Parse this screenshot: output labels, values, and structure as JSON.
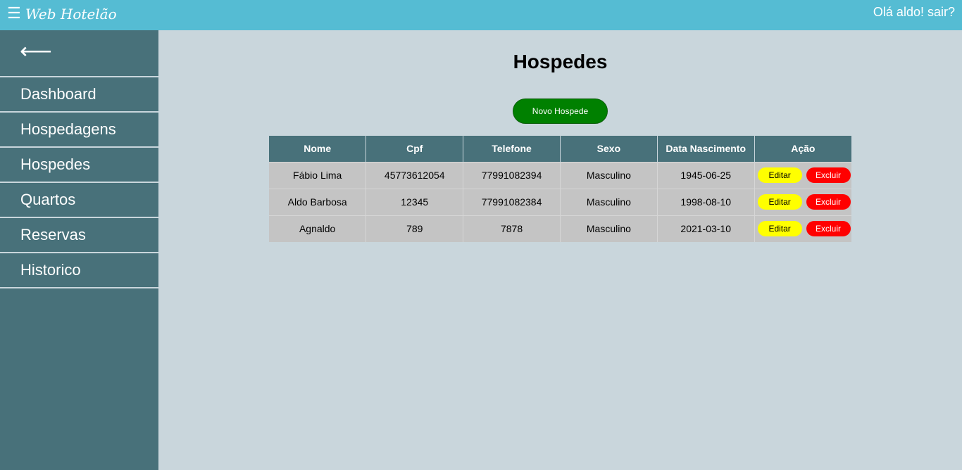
{
  "header": {
    "menu_icon": "☰",
    "brand": "Web Hotelão",
    "greeting": "Olá aldo!",
    "logout": "sair?"
  },
  "sidebar": {
    "back_icon": "⟵",
    "items": [
      {
        "label": "Dashboard"
      },
      {
        "label": "Hospedagens"
      },
      {
        "label": "Hospedes"
      },
      {
        "label": "Quartos"
      },
      {
        "label": "Reservas"
      },
      {
        "label": "Historico"
      }
    ]
  },
  "main": {
    "title": "Hospedes",
    "new_button": "Novo Hospede",
    "table": {
      "headers": [
        "Nome",
        "Cpf",
        "Telefone",
        "Sexo",
        "Data Nascimento",
        "Ação"
      ],
      "rows": [
        {
          "nome": "Fábio Lima",
          "cpf": "45773612054",
          "telefone": "77991082394",
          "sexo": "Masculino",
          "nascimento": "1945-06-25"
        },
        {
          "nome": "Aldo Barbosa",
          "cpf": "12345",
          "telefone": "77991082384",
          "sexo": "Masculino",
          "nascimento": "1998-08-10"
        },
        {
          "nome": "Agnaldo",
          "cpf": "789",
          "telefone": "7878",
          "sexo": "Masculino",
          "nascimento": "2021-03-10"
        }
      ],
      "edit_label": "Editar",
      "delete_label": "Excluir"
    }
  },
  "colors": {
    "topbar": "#55bcd3",
    "sidebar": "#48717a",
    "background": "#c9d6dc",
    "new_button": "#008000",
    "edit_button": "#ffff00",
    "delete_button": "#ff0000"
  }
}
